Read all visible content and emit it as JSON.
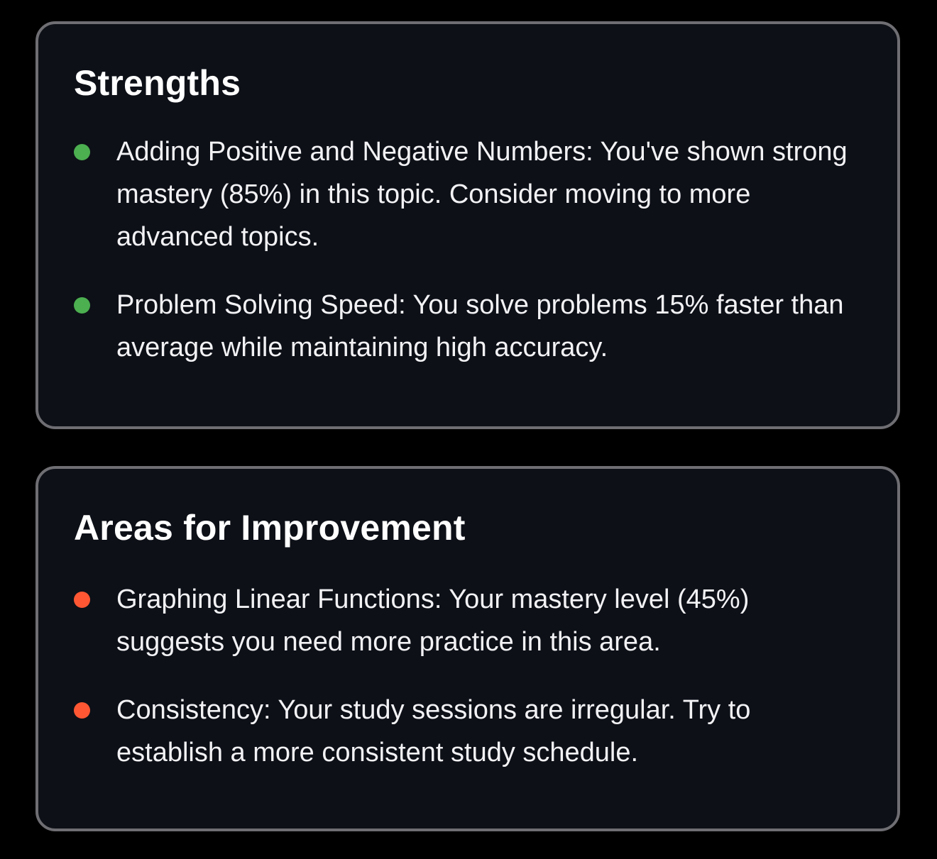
{
  "colors": {
    "background": "#000000",
    "card_background": "#0d1017",
    "card_border": "#6e6e73",
    "strength_dot": "#4caf50",
    "improvement_dot": "#ff5733"
  },
  "strengths": {
    "title": "Strengths",
    "items": [
      {
        "text": "Adding Positive and Negative Numbers: You've shown strong mastery (85%) in this topic. Consider moving to more advanced topics."
      },
      {
        "text": "Problem Solving Speed: You solve problems 15% faster than average while maintaining high accuracy."
      }
    ]
  },
  "improvement": {
    "title": "Areas for Improvement",
    "items": [
      {
        "text": "Graphing Linear Functions: Your mastery level (45%) suggests you need more practice in this area."
      },
      {
        "text": "Consistency: Your study sessions are irregular. Try to establish a more consistent study schedule."
      }
    ]
  }
}
